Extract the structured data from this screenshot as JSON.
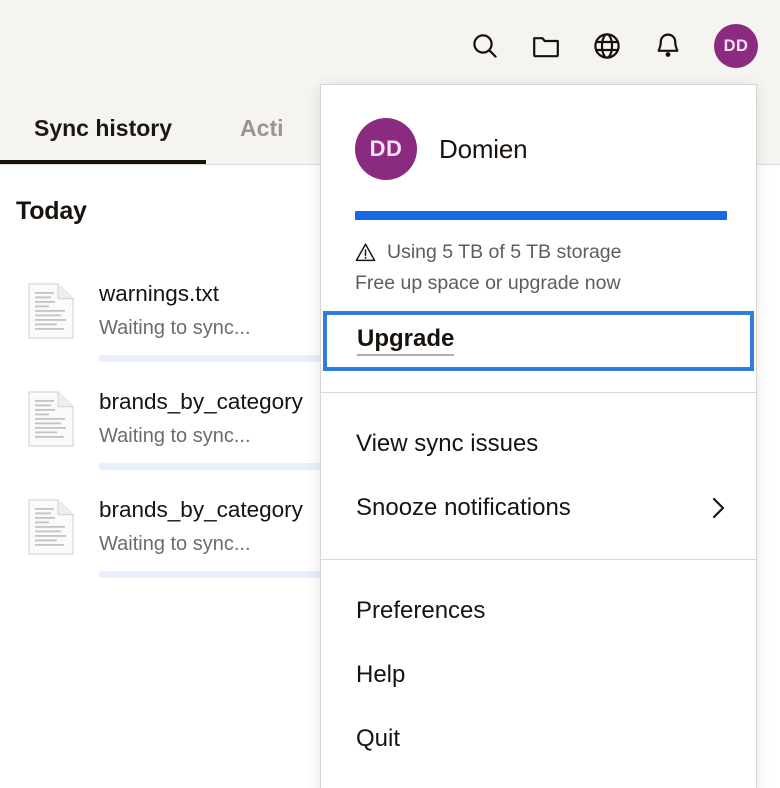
{
  "topbar": {
    "icons": [
      {
        "name": "search-icon",
        "label": "Search"
      },
      {
        "name": "folder-icon",
        "label": "Open folder"
      },
      {
        "name": "globe-icon",
        "label": "Open on the web"
      },
      {
        "name": "bell-icon",
        "label": "Notifications"
      }
    ],
    "avatar": {
      "initials": "DD",
      "color": "#8a2a80"
    }
  },
  "tabs": [
    {
      "label": "Sync history",
      "active": true
    },
    {
      "label": "Acti",
      "active": false
    }
  ],
  "content": {
    "section_title": "Today",
    "files": [
      {
        "name": "warnings.txt",
        "status": "Waiting to sync...",
        "progress": 0
      },
      {
        "name": "brands_by_category",
        "status": "Waiting to sync...",
        "progress": 0
      },
      {
        "name": "brands_by_category",
        "status": "Waiting to sync...",
        "progress": 0
      }
    ]
  },
  "menu": {
    "account": {
      "initials": "DD",
      "name": "Domien",
      "avatar_color": "#8a2a80"
    },
    "storage": {
      "percent": 100,
      "bar_color": "#1668e3",
      "warning_text": "Using 5 TB of 5 TB storage",
      "subtext": "Free up space or upgrade now"
    },
    "upgrade": {
      "label": "Upgrade",
      "focused": true,
      "focus_color": "#2f7de1"
    },
    "items_group_1": [
      {
        "label": "View sync issues",
        "chevron": false
      },
      {
        "label": "Snooze notifications",
        "chevron": true
      }
    ],
    "items_group_2": [
      {
        "label": "Preferences",
        "chevron": false
      },
      {
        "label": "Help",
        "chevron": false
      },
      {
        "label": "Quit",
        "chevron": false
      }
    ]
  }
}
